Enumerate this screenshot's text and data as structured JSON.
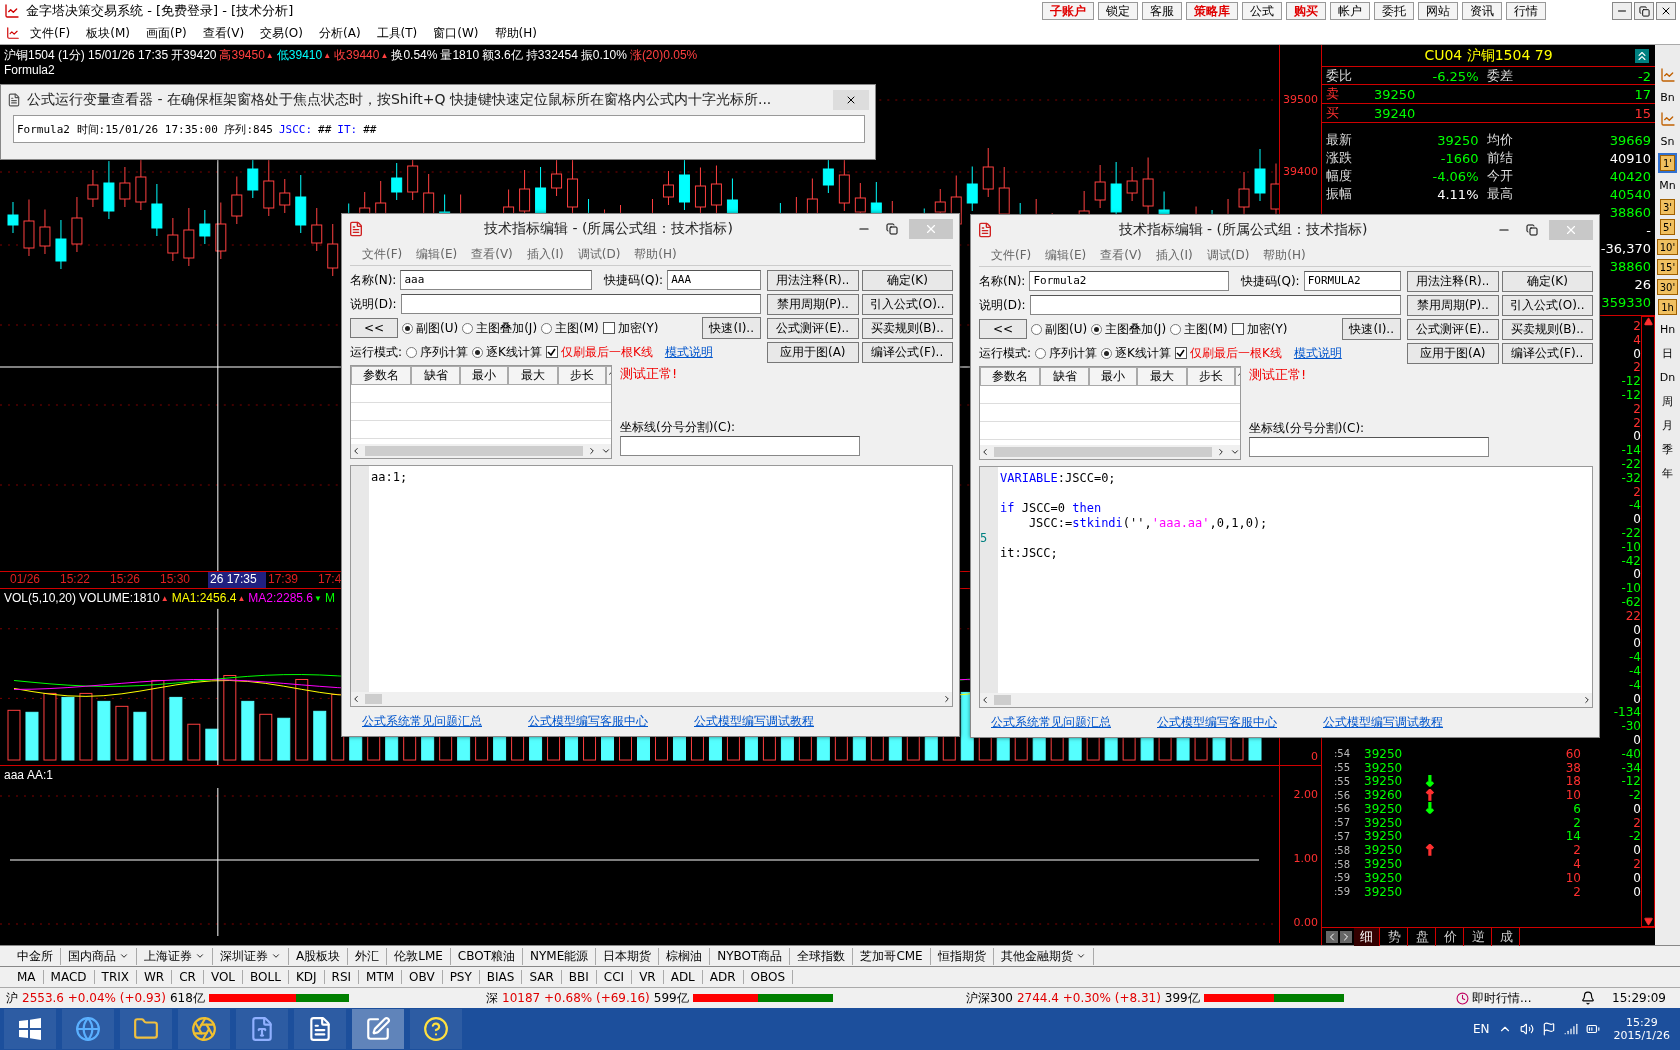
{
  "window": {
    "title": "金字塔决策交易系统 - [免费登录] - [技术分析]",
    "buttons": [
      {
        "label": "子账户",
        "highlighted": true
      },
      {
        "label": "锁定",
        "highlighted": false
      },
      {
        "label": "客服",
        "highlighted": false
      },
      {
        "label": "策略库",
        "highlighted": true
      },
      {
        "label": "公式",
        "highlighted": false
      },
      {
        "label": "购买",
        "highlighted": true
      },
      {
        "label": "帐户",
        "highlighted": false
      },
      {
        "label": "委托",
        "highlighted": false
      },
      {
        "label": "网站",
        "highlighted": false
      },
      {
        "label": "资讯",
        "highlighted": false
      },
      {
        "label": "行情",
        "highlighted": false
      }
    ]
  },
  "menu": [
    "文件(F)",
    "板块(M)",
    "画面(P)",
    "查看(V)",
    "交易(O)",
    "分析(A)",
    "工具(T)",
    "窗口(W)",
    "帮助(H)"
  ],
  "chart": {
    "header": [
      {
        "text": "沪铜1504 (1分) 15/01/26 17:35",
        "color": "#ffffff"
      },
      {
        "text": "开39420",
        "color": "#ffffff"
      },
      {
        "text": "高39450",
        "color": "#ff4040",
        "arrow": {
          "text": "▲",
          "color": "#ff4040"
        }
      },
      {
        "text": "低39410",
        "color": "#00ffff",
        "arrow": {
          "text": "▲",
          "color": "#ff4040"
        }
      },
      {
        "text": "收39440",
        "color": "#ff4040",
        "arrow": {
          "text": "▲",
          "color": "#ff4040"
        }
      },
      {
        "text": "换0.54%",
        "color": "#ffffff"
      },
      {
        "text": "量1810",
        "color": "#ffffff"
      },
      {
        "text": "额3.6亿",
        "color": "#ffffff"
      },
      {
        "text": "持332454",
        "color": "#ffffff"
      },
      {
        "text": "振0.10%",
        "color": "#ffffff"
      },
      {
        "text": "涨(20)0.05%",
        "color": "#ff4040"
      }
    ],
    "formula_label": "Formula2",
    "price_axis": [
      "39500",
      "39400"
    ],
    "time_axis": [
      {
        "label": "01/26",
        "selected": false
      },
      {
        "label": "15:22",
        "selected": false
      },
      {
        "label": "15:26",
        "selected": false
      },
      {
        "label": "15:30",
        "selected": false
      },
      {
        "label": "26 17:35",
        "selected": true
      },
      {
        "label": "17:39",
        "selected": false
      },
      {
        "label": "17:4",
        "selected": false
      }
    ],
    "volume_header": [
      {
        "text": "VOL(5,10,20)",
        "color": "#ffffff"
      },
      {
        "text": "VOLUME:1810",
        "color": "#ffffff",
        "arrow": {
          "text": "▲",
          "color": "#ff4040"
        }
      },
      {
        "text": "MA1:2456.4",
        "color": "#ffff00",
        "arrow": {
          "text": "▲",
          "color": "#ff4040"
        }
      },
      {
        "text": "MA2:2285.6",
        "color": "#ff00ff",
        "arrow": {
          "text": "▼",
          "color": "#00ff00"
        }
      },
      {
        "text": "M",
        "color": "#00ff00"
      }
    ],
    "volume_axis": [
      "0"
    ],
    "indicator_header": [
      {
        "text": "aaa",
        "color": "#ffffff"
      },
      {
        "text": "AA:1",
        "color": "#ffffff"
      }
    ],
    "indicator_axis": [
      "2.00",
      "1.00",
      "0.00"
    ]
  },
  "variable_viewer": {
    "title": "公式运行变量查看器 - 在确保框架窗格处于焦点状态时，按Shift+Q 快捷键快速定位鼠标所在窗格内公式内十字光标所...",
    "content": [
      {
        "text": "Formula2 时间:15/01/26 17:35:00 序列:845",
        "kind": "plain"
      },
      {
        "text": "JSCC:",
        "kind": "variable"
      },
      {
        "text": "##",
        "kind": "plain"
      },
      {
        "text": "IT:",
        "kind": "variable"
      },
      {
        "text": "##",
        "kind": "plain"
      }
    ]
  },
  "editors": [
    {
      "title": "技术指标编辑 - (所属公式组：技术指标)",
      "menus": [
        "文件(F)",
        "编辑(E)",
        "查看(V)",
        "插入(I)",
        "调试(D)",
        "帮助(H)"
      ],
      "name_label": "名称(N):",
      "name": "aaa",
      "shortcut_label": "快捷码(Q):",
      "shortcut": "AAA",
      "description_label": "说明(D):",
      "collapse_button": "<<",
      "chart_types": [
        {
          "label": "副图(U)",
          "selected": true
        },
        {
          "label": "主图叠加(J)",
          "selected": false
        },
        {
          "label": "主图(M)",
          "selected": false
        }
      ],
      "encrypt": {
        "label": "加密(Y)",
        "checked": false
      },
      "quick_button": "快速(I)..",
      "run_mode_label": "运行模式:",
      "run_modes": [
        {
          "label": "序列计算",
          "selected": false
        },
        {
          "label": "逐K线计算",
          "selected": true
        }
      ],
      "refresh_last": {
        "label": "仅刷最后一根K线",
        "checked": true
      },
      "mode_help_link": "模式说明",
      "buttons": [
        "用法注释(R)..",
        "确定(K)",
        "禁用周期(P)..",
        "引入公式(O)..",
        "公式测评(E)..",
        "买卖规则(B)..",
        "应用于图(A)",
        "编译公式(F).."
      ],
      "param_columns": [
        "参数名",
        "缺省",
        "最小",
        "最大",
        "步长"
      ],
      "status": "测试正常!",
      "axis_lines_label": "坐标线(分号分割)(C):",
      "code": [
        {
          "kind": "code",
          "tokens": [
            {
              "text": "aa:1;",
              "kind": "plain"
            }
          ]
        }
      ],
      "links": [
        "公式系统常见问题汇总",
        "公式模型编写客服中心",
        "公式模型编写调试教程"
      ]
    },
    {
      "title": "技术指标编辑 - (所属公式组：技术指标)",
      "menus": [
        "文件(F)",
        "编辑(E)",
        "查看(V)",
        "插入(I)",
        "调试(D)",
        "帮助(H)"
      ],
      "name_label": "名称(N):",
      "name": "Formula2",
      "shortcut_label": "快捷码(Q):",
      "shortcut": "FORMULA2",
      "description_label": "说明(D):",
      "collapse_button": "<<",
      "chart_types": [
        {
          "label": "副图(U)",
          "selected": false
        },
        {
          "label": "主图叠加(J)",
          "selected": true
        },
        {
          "label": "主图(M)",
          "selected": false
        }
      ],
      "encrypt": {
        "label": "加密(Y)",
        "checked": false
      },
      "quick_button": "快速(I)..",
      "run_mode_label": "运行模式:",
      "run_modes": [
        {
          "label": "序列计算",
          "selected": false
        },
        {
          "label": "逐K线计算",
          "selected": true
        }
      ],
      "refresh_last": {
        "label": "仅刷最后一根K线",
        "checked": true
      },
      "mode_help_link": "模式说明",
      "buttons": [
        "用法注释(R)..",
        "确定(K)",
        "禁用周期(P)..",
        "引入公式(O)..",
        "公式测评(E)..",
        "买卖规则(B)..",
        "应用于图(A)",
        "编译公式(F).."
      ],
      "param_columns": [
        "参数名",
        "缺省",
        "最小",
        "最大",
        "步长"
      ],
      "status": "测试正常!",
      "axis_lines_label": "坐标线(分号分割)(C):",
      "code": [
        {
          "kind": "code",
          "tokens": [
            {
              "text": "VARIABLE",
              "kind": "keyword"
            },
            {
              "text": ":JSCC=0;",
              "kind": "plain"
            }
          ]
        },
        {
          "kind": "blank"
        },
        {
          "kind": "code",
          "tokens": [
            {
              "text": "if",
              "kind": "keyword"
            },
            {
              "text": " JSCC=0 ",
              "kind": "plain"
            },
            {
              "text": "then",
              "kind": "keyword"
            }
          ]
        },
        {
          "kind": "code",
          "tokens": [
            {
              "text": "    JSCC:=",
              "kind": "plain"
            },
            {
              "text": "stkindi",
              "kind": "keyword"
            },
            {
              "text": "('',",
              "kind": "plain"
            },
            {
              "text": "'aaa.aa'",
              "kind": "string"
            },
            {
              "text": ",0,1,0);",
              "kind": "plain"
            }
          ]
        },
        {
          "kind": "blank",
          "marker": "5"
        },
        {
          "kind": "code",
          "tokens": [
            {
              "text": "it:JSCC;",
              "kind": "plain"
            }
          ]
        }
      ],
      "links": [
        "公式系统常见问题汇总",
        "公式模型编写客服中心",
        "公式模型编写调试教程"
      ]
    }
  ],
  "quote": {
    "title": "CU04  沪铜1504  79",
    "summary": {
      "label": "委比",
      "value": "-6.25%",
      "label_2": "委差",
      "value_2": "-2"
    },
    "ask": {
      "label": "卖",
      "price": "39250",
      "volume": "17"
    },
    "bid": {
      "label": "买",
      "price": "39240",
      "volume": "15"
    },
    "stats": [
      [
        {
          "label": "最新",
          "value": "39250",
          "color": "#00ff00"
        },
        {
          "label": "均价",
          "value": "39669",
          "color": "#00ff00"
        }
      ],
      [
        {
          "label": "涨跌",
          "value": "-1660",
          "color": "#00ff00"
        },
        {
          "label": "前结",
          "value": "40910",
          "color": "#ffffff"
        }
      ],
      [
        {
          "label": "幅度",
          "value": "-4.06%",
          "color": "#00ff00"
        },
        {
          "label": "今开",
          "value": "40420",
          "color": "#00ff00"
        }
      ],
      [
        {
          "label": "振幅",
          "value": "4.11%",
          "color": "#ffffff"
        },
        {
          "label": "最高",
          "value": "40540",
          "color": "#00ff00"
        }
      ]
    ],
    "stats_partial": [
      {
        "value": "38860",
        "color": "#00ff00"
      },
      {
        "value": "-",
        "color": "#ffffff"
      },
      {
        "value": "-36,370",
        "color": "#ffffff"
      },
      {
        "value": "38860",
        "color": "#00ff00"
      },
      {
        "value": "26",
        "color": "#ffffff"
      },
      {
        "value": "359330",
        "color": "#00ff00"
      }
    ],
    "ticks": [
      {
        "change": "2",
        "color": "#ff3030"
      },
      {
        "change": "4",
        "color": "#ff3030"
      },
      {
        "change": "0",
        "color": "#ffffff"
      },
      {
        "change": "2",
        "color": "#ff3030"
      },
      {
        "change": "-12",
        "color": "#00ff00"
      },
      {
        "change": "-12",
        "color": "#00ff00"
      },
      {
        "change": "2",
        "color": "#ff3030"
      },
      {
        "change": "2",
        "color": "#ff3030"
      },
      {
        "change": "0",
        "color": "#ffffff"
      },
      {
        "change": "-14",
        "color": "#00ff00"
      },
      {
        "change": "-22",
        "color": "#00ff00"
      },
      {
        "change": "-32",
        "color": "#00ff00"
      },
      {
        "change": "2",
        "color": "#ff3030"
      },
      {
        "change": "-4",
        "color": "#00ff00"
      },
      {
        "change": "0",
        "color": "#ffffff"
      },
      {
        "change": "-22",
        "color": "#00ff00"
      },
      {
        "change": "-10",
        "color": "#00ff00"
      },
      {
        "change": "-42",
        "color": "#00ff00"
      },
      {
        "change": "0",
        "color": "#ffffff"
      },
      {
        "change": "-10",
        "color": "#00ff00"
      },
      {
        "change": "-62",
        "color": "#00ff00"
      },
      {
        "change": "22",
        "color": "#ff3030"
      },
      {
        "change": "0",
        "color": "#ffffff"
      },
      {
        "change": "0",
        "color": "#ffffff"
      },
      {
        "change": "-4",
        "color": "#00ff00"
      },
      {
        "change": "-4",
        "color": "#00ff00"
      },
      {
        "change": "-4",
        "color": "#00ff00"
      },
      {
        "change": "0",
        "color": "#ffffff"
      },
      {
        "change": "-134",
        "color": "#00ff00"
      },
      {
        "change": "-30",
        "color": "#00ff00"
      },
      {
        "change": "0",
        "color": "#ffffff"
      },
      {
        "time": ":54",
        "price": "39250",
        "volume": {
          "text": "60",
          "color": "#ff3030"
        },
        "change": "-40",
        "color": "#00ff00"
      },
      {
        "time": ":55",
        "price": "39250",
        "volume": {
          "text": "38",
          "color": "#ff3030"
        },
        "change": "-34",
        "color": "#00ff00"
      },
      {
        "time": ":55",
        "price": "39250",
        "arrow": {
          "text": "↓",
          "color": "#00ff00"
        },
        "volume": {
          "text": "18",
          "color": "#ff3030"
        },
        "change": "-12",
        "color": "#00ff00"
      },
      {
        "time": ":56",
        "price": "39260",
        "arrow": {
          "text": "↑",
          "color": "#ff3030"
        },
        "volume": {
          "text": "10",
          "color": "#ff3030"
        },
        "change": "-2",
        "color": "#00ff00"
      },
      {
        "time": ":56",
        "price": "39250",
        "arrow": {
          "text": "↓",
          "color": "#00ff00"
        },
        "volume": {
          "text": "6",
          "color": "#00ff00"
        },
        "change": "0",
        "color": "#ffffff"
      },
      {
        "time": ":57",
        "price": "39250",
        "volume": {
          "text": "2",
          "color": "#00ff00"
        },
        "change": "2",
        "color": "#ff3030"
      },
      {
        "time": ":57",
        "price": "39250",
        "volume": {
          "text": "14",
          "color": "#00ff00"
        },
        "change": "-2",
        "color": "#00ff00"
      },
      {
        "time": ":58",
        "price": "39250",
        "arrow": {
          "text": "↑",
          "color": "#ff3030"
        },
        "volume": {
          "text": "2",
          "color": "#ff3030"
        },
        "change": "0",
        "color": "#ffffff"
      },
      {
        "time": ":58",
        "price": "39250",
        "volume": {
          "text": "4",
          "color": "#ff3030"
        },
        "change": "2",
        "color": "#ff3030"
      },
      {
        "time": ":59",
        "price": "39250",
        "volume": {
          "text": "10",
          "color": "#ff3030"
        },
        "change": "0",
        "color": "#ffffff"
      },
      {
        "time": ":59",
        "price": "39250",
        "volume": {
          "text": "2",
          "color": "#ff3030"
        },
        "change": "0",
        "color": "#ffffff"
      }
    ],
    "tabs": [
      {
        "label": "细",
        "selected": true
      },
      {
        "label": "势",
        "selected": false
      },
      {
        "label": "盘",
        "selected": false
      },
      {
        "label": "价",
        "selected": false
      },
      {
        "label": "逆",
        "selected": false
      },
      {
        "label": "成",
        "selected": false
      }
    ]
  },
  "period_bar": [
    {
      "kind": "icon",
      "selected": false
    },
    {
      "kind": "text",
      "label": "Bn",
      "selected": false
    },
    {
      "kind": "icon",
      "selected": false
    },
    {
      "kind": "text",
      "label": "Sn",
      "selected": false
    },
    {
      "kind": "box",
      "label": "1'",
      "selected": true
    },
    {
      "kind": "text",
      "label": "Mn",
      "selected": false
    },
    {
      "kind": "box",
      "label": "3'",
      "selected": false
    },
    {
      "kind": "box",
      "label": "5'",
      "selected": false
    },
    {
      "kind": "box",
      "label": "10'",
      "selected": false
    },
    {
      "kind": "box",
      "label": "15'",
      "selected": false
    },
    {
      "kind": "box",
      "label": "30'",
      "selected": false
    },
    {
      "kind": "box",
      "label": "1h",
      "selected": false
    },
    {
      "kind": "text",
      "label": "Hn",
      "selected": false
    },
    {
      "kind": "text",
      "label": "日",
      "selected": false
    },
    {
      "kind": "text",
      "label": "Dn",
      "selected": false
    },
    {
      "kind": "text",
      "label": "周",
      "selected": false
    },
    {
      "kind": "text",
      "label": "月",
      "selected": false
    },
    {
      "kind": "text",
      "label": "季",
      "selected": false
    },
    {
      "kind": "text",
      "label": "年",
      "selected": false
    }
  ],
  "market_tabs": [
    {
      "label": "中金所",
      "dropdown": false
    },
    {
      "label": "国内商品",
      "dropdown": true
    },
    {
      "label": "上海证券",
      "dropdown": true
    },
    {
      "label": "深圳证券",
      "dropdown": true
    },
    {
      "label": "A股板块",
      "dropdown": false
    },
    {
      "label": "外汇",
      "dropdown": false
    },
    {
      "label": "伦敦LME",
      "dropdown": false
    },
    {
      "label": "CBOT粮油",
      "dropdown": false
    },
    {
      "label": "NYME能源",
      "dropdown": false
    },
    {
      "label": "日本期货",
      "dropdown": false
    },
    {
      "label": "棕榈油",
      "dropdown": false
    },
    {
      "label": "NYBOT商品",
      "dropdown": false
    },
    {
      "label": "全球指数",
      "dropdown": false
    },
    {
      "label": "芝加哥CME",
      "dropdown": false
    },
    {
      "label": "恒指期货",
      "dropdown": false
    },
    {
      "label": "其他金融期货",
      "dropdown": true
    }
  ],
  "indicator_tabs": [
    "MA",
    "MACD",
    "TRIX",
    "WR",
    "CR",
    "VOL",
    "BOLL",
    "KDJ",
    "RSI",
    "MTM",
    "OBV",
    "PSY",
    "BIAS",
    "SAR",
    "BBI",
    "CCI",
    "VR",
    "ADL",
    "ADR",
    "OBOS"
  ],
  "status_bar": {
    "indices": [
      {
        "market": "沪",
        "value": "2553.6 +0.04% (+0.93)",
        "amount": "618亿",
        "level": 0.62
      },
      {
        "market": "深",
        "value": "10187 +0.68% (+69.16)",
        "amount": "599亿",
        "level": 0.47
      },
      {
        "market": "沪深300",
        "value": "2744.4 +0.30% (+8.31)",
        "amount": "399亿",
        "level": 0.5
      }
    ],
    "ticker": "即时行情...",
    "clock": "15:29:09"
  },
  "taskbar": {
    "apps": [
      {
        "kind": "browser",
        "selected": false
      },
      {
        "kind": "folder",
        "selected": false
      },
      {
        "kind": "chrome",
        "selected": false
      },
      {
        "kind": "visio",
        "selected": false
      },
      {
        "kind": "word",
        "selected": false
      },
      {
        "kind": "trading",
        "selected": true
      },
      {
        "kind": "help",
        "selected": false
      }
    ],
    "language": "EN",
    "time": "15:29",
    "date": "2015/1/26"
  }
}
